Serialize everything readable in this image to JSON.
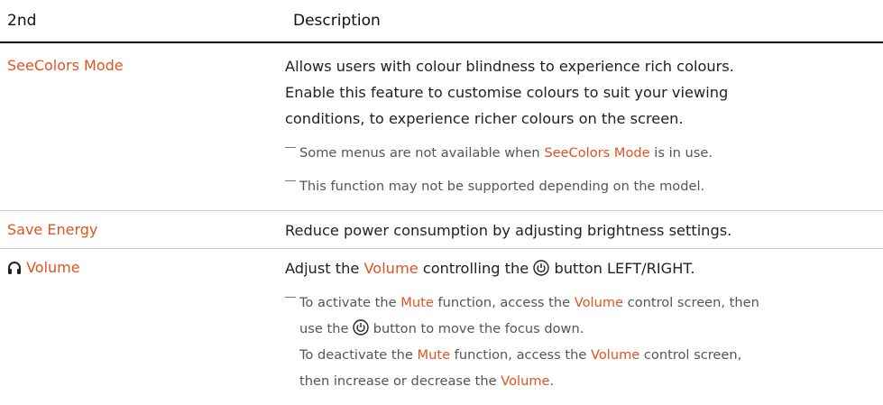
{
  "table": {
    "headers": {
      "col1": "2nd",
      "col2": "Description"
    },
    "rows": {
      "seecolors": {
        "name": "SeeColors Mode",
        "desc_lines": [
          "Allows users with colour blindness to experience rich colours.",
          "Enable this feature to customise colours to suit your viewing",
          "conditions, to experience richer colours on the screen."
        ],
        "note1": {
          "before": "Some menus are not available when ",
          "hl": "SeeColors Mode",
          "after": " is in use."
        },
        "note2": "This function may not be supported depending on the model."
      },
      "save_energy": {
        "name": "Save Energy",
        "desc": "Reduce power consumption by adjusting brightness settings."
      },
      "volume": {
        "name": "Volume",
        "icon": "headphones-icon",
        "desc": {
          "before": "Adjust the ",
          "hl": "Volume",
          "mid": " controlling the ",
          "after": " button LEFT/RIGHT.",
          "icon": "joystick-icon"
        },
        "note": {
          "l1_before": "To activate the ",
          "l1_hl1": "Mute",
          "l1_mid": " function, access the ",
          "l1_hl2": "Volume",
          "l1_after": " control screen, then",
          "l2_before": "use the ",
          "l2_after": " button to move the focus down.",
          "l3_before": "To deactivate the ",
          "l3_hl1": "Mute",
          "l3_mid": " function, access the ",
          "l3_hl2": "Volume",
          "l3_after": " control screen,",
          "l4_before": "then increase or decrease the ",
          "l4_hl": "Volume",
          "l4_after": "."
        }
      }
    }
  },
  "colors": {
    "accent": "#e0541f",
    "text": "#222222",
    "rule": "#000000",
    "divider": "#c8c8c8"
  }
}
